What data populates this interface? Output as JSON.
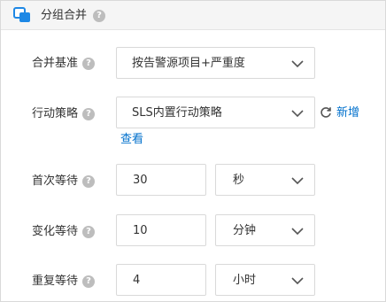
{
  "header": {
    "title": "分组合并",
    "help": "?"
  },
  "colors": {
    "link": "#0070cc",
    "brand": "#1e88e5",
    "border": "#d9d9d9",
    "header_bg": "#f5f5f5"
  },
  "fields": {
    "merge_basis": {
      "label": "合并基准",
      "value": "按告警源项目+严重度"
    },
    "action_policy": {
      "label": "行动策略",
      "value": "SLS内置行动策略",
      "new_label": "新增",
      "view_label": "查看"
    },
    "first_wait": {
      "label": "首次等待",
      "value": "30",
      "unit": "秒"
    },
    "change_wait": {
      "label": "变化等待",
      "value": "10",
      "unit": "分钟"
    },
    "repeat_wait": {
      "label": "重复等待",
      "value": "4",
      "unit": "小时"
    }
  },
  "icons": {
    "header": "merge-group-icon",
    "help": "question-circle-icon",
    "dropdown": "chevron-down-icon",
    "refresh": "refresh-icon"
  }
}
